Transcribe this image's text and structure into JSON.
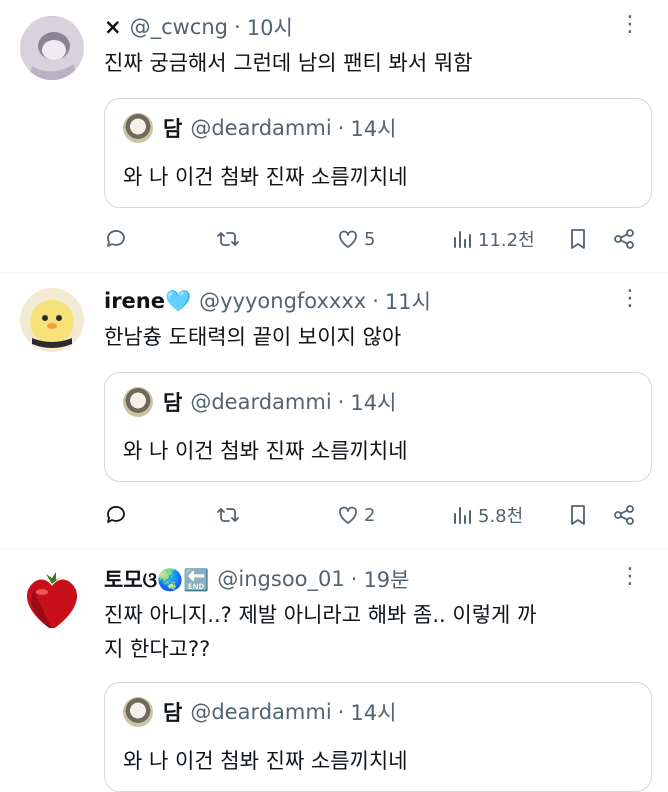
{
  "posts": [
    {
      "display_name": "×",
      "handle": "@_cwcng",
      "time": "10시",
      "text": "진짜 궁금해서 그런데 남의 팬티 봐서 뭐함",
      "quote": {
        "name": "담",
        "handle": "@deardammi",
        "time": "14시",
        "text": "와 나 이건 첨봐 진짜 소름끼치네"
      },
      "replies": "",
      "reposts": "",
      "likes": "5",
      "views": "11.2천"
    },
    {
      "display_name": "irene🩵",
      "handle": "@yyyongfoxxxx",
      "time": "11시",
      "text": "한남츙 도태력의 끝이 보이지 않아",
      "quote": {
        "name": "담",
        "handle": "@deardammi",
        "time": "14시",
        "text": "와 나 이건 첨봐 진짜 소름끼치네"
      },
      "replies": "",
      "reposts": "",
      "likes": "2",
      "views": "5.8천"
    },
    {
      "display_name": "토모ଓ🌏🔚",
      "handle": "@ingsoo_01",
      "time": "19분",
      "text": "진짜 아니지..? 제발 아니라고 해봐 좀.. 이렇게 까지 한다고??",
      "quote": {
        "name": "담",
        "handle": "@deardammi",
        "time": "14시",
        "text": "와 나 이건 첨봐 진짜 소름끼치네"
      }
    }
  ],
  "ui": {
    "dot": "·",
    "more": "⋮"
  },
  "colors": {
    "secondary_text": "#536471",
    "border": "#cfd9de",
    "divider": "#eff3f4"
  }
}
